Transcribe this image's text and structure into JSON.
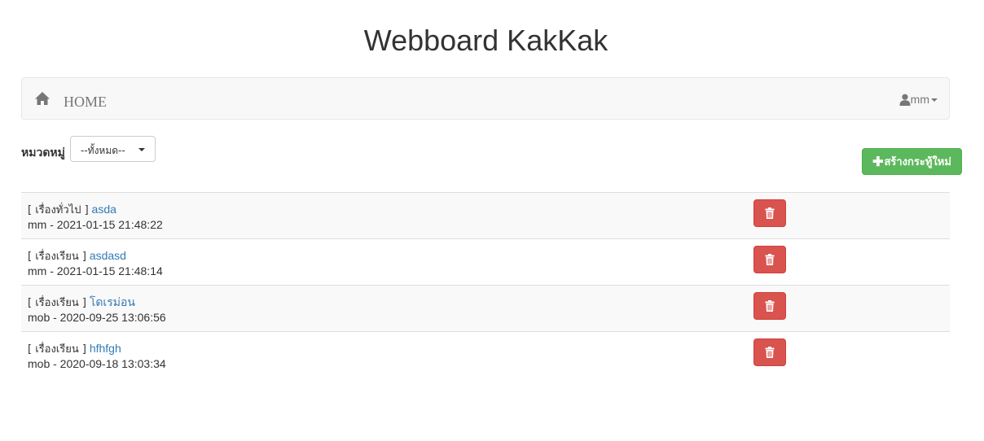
{
  "page": {
    "title": "Webboard KakKak"
  },
  "navbar": {
    "home_icon": "home-icon",
    "home_label": "HOME",
    "user_icon": "user-icon",
    "user_name": "mm"
  },
  "filter": {
    "label": "หมวดหมู่",
    "selected": "--ทั้งหมด--"
  },
  "new_post_button": {
    "icon": "plus-icon",
    "label": "สร้างกระทู้ใหม่"
  },
  "colors": {
    "link": "#337ab7",
    "success": "#5cb85c",
    "danger": "#d9534f"
  },
  "posts": [
    {
      "category": "[ เรื่องทั่วไป ]",
      "title": "asda",
      "meta": "mm - 2021-01-15 21:48:22"
    },
    {
      "category": "[ เรื่องเรียน ]",
      "title": "asdasd",
      "meta": "mm - 2021-01-15 21:48:14"
    },
    {
      "category": "[ เรื่องเรียน ]",
      "title": "โดเรม่อน",
      "meta": "mob - 2020-09-25 13:06:56"
    },
    {
      "category": "[ เรื่องเรียน ]",
      "title": "hfhfgh",
      "meta": "mob - 2020-09-18 13:03:34"
    }
  ]
}
